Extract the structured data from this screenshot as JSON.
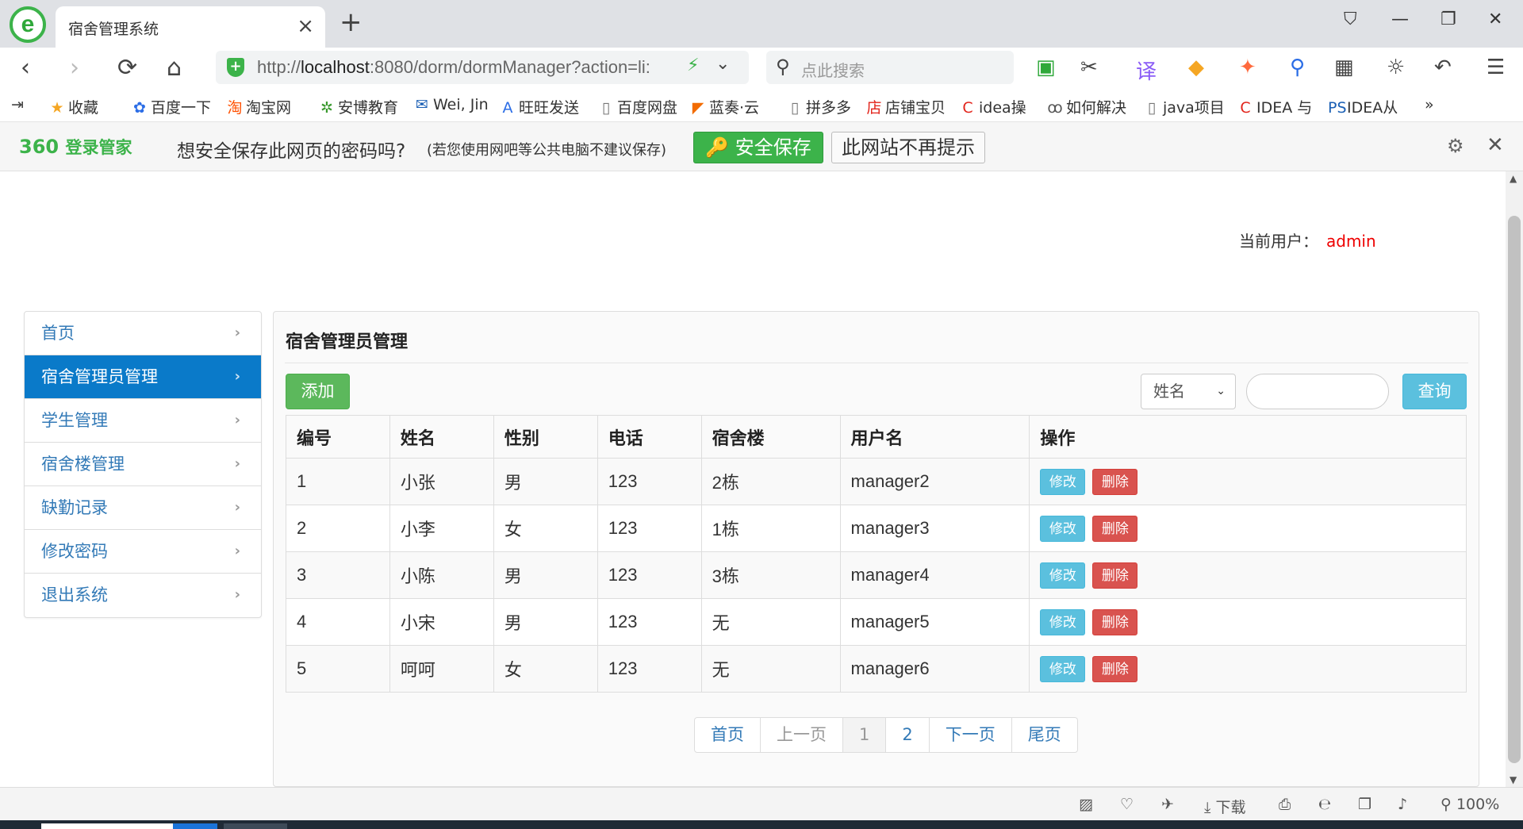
{
  "browser": {
    "tab_title": "宿舍管理系统",
    "tab_close": "×",
    "new_tab": "+",
    "url_prefix": "http://",
    "url_host": "localhost",
    "url_rest": ":8080/dorm/dormManager?action=li:",
    "search_placeholder": "点此搜索",
    "icons": {
      "back": "‹",
      "forward": "›",
      "reload": "⟳",
      "home": "⌂",
      "search": "⚲",
      "bolt": "⚡",
      "chevron": "⌄",
      "shirt": "⛉",
      "minimize": "—",
      "restore": "❐",
      "close": "✕",
      "menu": "☰"
    }
  },
  "bookmarks": [
    {
      "label": "收藏",
      "icon": "★",
      "color": "#f5a623"
    },
    {
      "label": "百度一下",
      "icon": "✿",
      "color": "#2b6de6"
    },
    {
      "label": "淘宝网",
      "icon": "淘",
      "color": "#ff5000"
    },
    {
      "label": "安博教育",
      "icon": "✲",
      "color": "#3a9a2e"
    },
    {
      "label": "Wei, Jin",
      "icon": "✉",
      "color": "#1a5fb4"
    },
    {
      "label": "旺旺发送",
      "icon": "A",
      "color": "#2b6de6"
    },
    {
      "label": "百度网盘",
      "icon": "▯",
      "color": "#777"
    },
    {
      "label": "蓝奏·云",
      "icon": "◤",
      "color": "#f26b00"
    },
    {
      "label": "拼多多",
      "icon": "▯",
      "color": "#777"
    },
    {
      "label": "店铺宝贝",
      "icon": "店",
      "color": "#e2231a"
    },
    {
      "label": "idea操",
      "icon": "C",
      "color": "#e2231a"
    },
    {
      "label": "如何解决",
      "icon": "ꝏ",
      "color": "#555"
    },
    {
      "label": "java项目",
      "icon": "▯",
      "color": "#777"
    },
    {
      "label": "IDEA 与",
      "icon": "C",
      "color": "#e2231a"
    },
    {
      "label": "IDEA从",
      "icon": "PS",
      "color": "#1a5fb4"
    }
  ],
  "bookmarks_more": "»",
  "password_bar": {
    "brand": "360",
    "brand_sub": "登录管家",
    "question": "想安全保存此网页的密码吗?",
    "note": "(若您使用网吧等公共电脑不建议保存)",
    "save_label": "安全保存",
    "never_label": "此网站不再提示",
    "gear": "⚙",
    "close": "✕"
  },
  "header": {
    "current_user_label": "当前用户：",
    "current_user": "admin"
  },
  "sidebar": {
    "chevron": "›",
    "items": [
      {
        "label": "首页",
        "active": false
      },
      {
        "label": "宿舍管理员管理",
        "active": true
      },
      {
        "label": "学生管理",
        "active": false
      },
      {
        "label": "宿舍楼管理",
        "active": false
      },
      {
        "label": "缺勤记录",
        "active": false
      },
      {
        "label": "修改密码",
        "active": false
      },
      {
        "label": "退出系统",
        "active": false
      }
    ]
  },
  "main": {
    "title": "宿舍管理员管理",
    "add_label": "添加",
    "filter_selected": "姓名",
    "search_value": "",
    "query_label": "查询",
    "columns": [
      "编号",
      "姓名",
      "性别",
      "电话",
      "宿舍楼",
      "用户名",
      "操作"
    ],
    "rows": [
      [
        "1",
        "小张",
        "男",
        "123",
        "2栋",
        "manager2"
      ],
      [
        "2",
        "小李",
        "女",
        "123",
        "1栋",
        "manager3"
      ],
      [
        "3",
        "小陈",
        "男",
        "123",
        "3栋",
        "manager4"
      ],
      [
        "4",
        "小宋",
        "男",
        "123",
        "无",
        "manager5"
      ],
      [
        "5",
        "呵呵",
        "女",
        "123",
        "无",
        "manager6"
      ]
    ],
    "edit_label": "修改",
    "delete_label": "删除",
    "pagination": {
      "first": "首页",
      "prev": "上一页",
      "pages": [
        "1",
        "2"
      ],
      "current": "1",
      "next": "下一页",
      "last": "尾页"
    }
  },
  "statusbar": {
    "download": "下载",
    "zoom": "100%"
  }
}
